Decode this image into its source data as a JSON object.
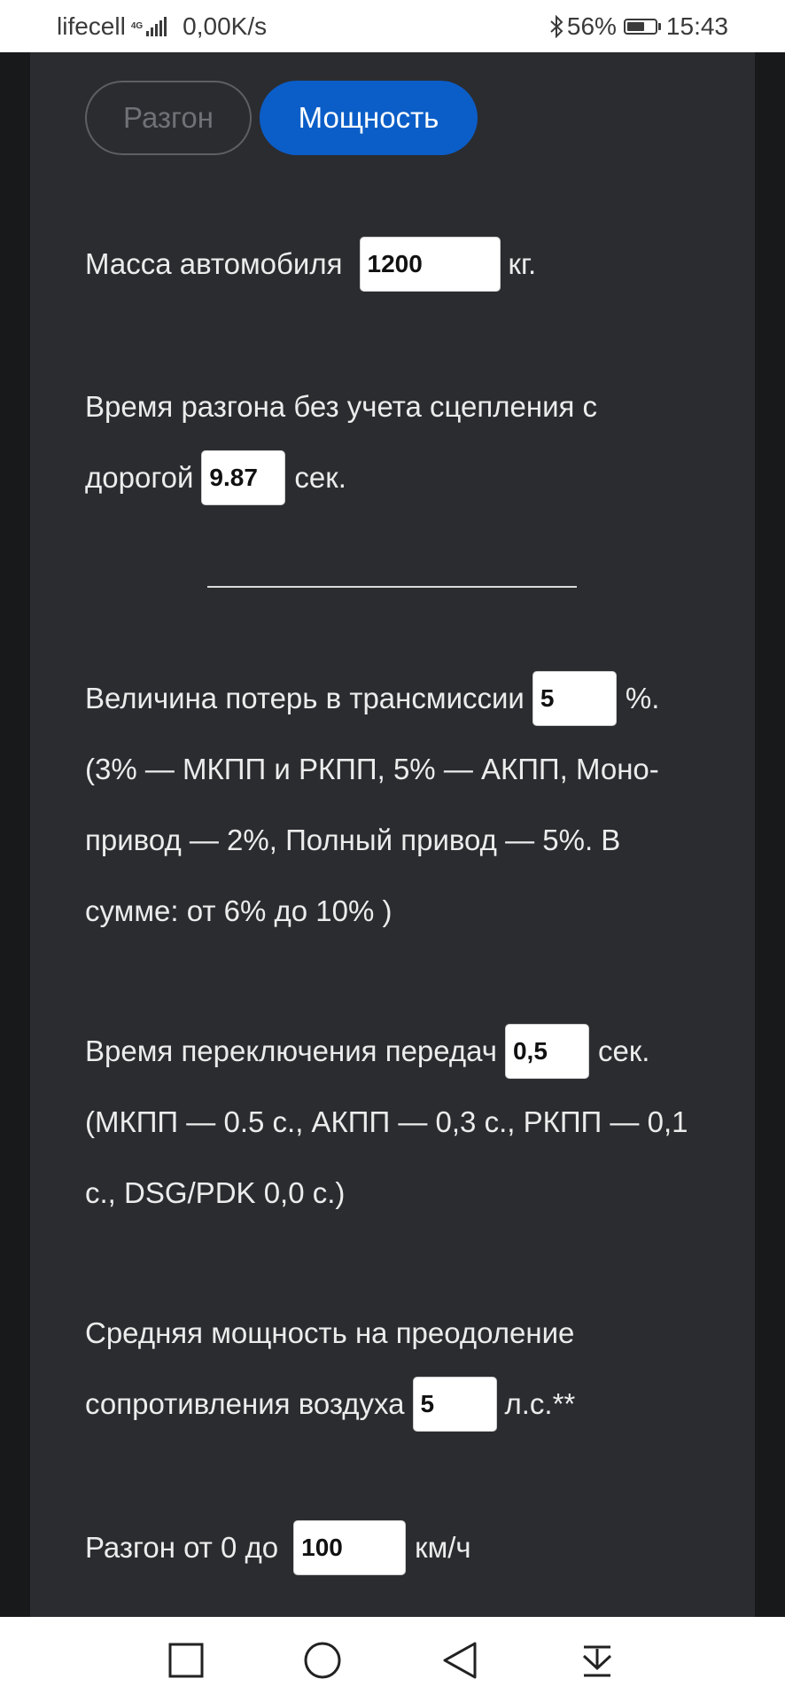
{
  "status_bar": {
    "carrier": "lifecell",
    "network_type": "4G",
    "speed": "0,00K/s",
    "battery": "56%",
    "time": "15:43"
  },
  "tabs": [
    {
      "label": "Разгон",
      "active": false
    },
    {
      "label": "Мощность",
      "active": true
    }
  ],
  "form": {
    "mass": {
      "label": "Масса автомобиля",
      "value": "1200",
      "unit": "кг."
    },
    "accel_time": {
      "line1": "Время разгона без учета сцепления с",
      "label": "дорогой",
      "value": "9.87",
      "unit": "сек."
    },
    "transmission_loss": {
      "label": "Величина потерь в трансмиссии",
      "value": "5",
      "unit": "%.",
      "note_lines": [
        "(3% — МКПП и РКПП, 5% — АКПП, Моно-",
        "привод — 2%, Полный привод — 5%. В",
        "сумме: от 6% до 10% )"
      ]
    },
    "shift_time": {
      "label": "Время переключения передач",
      "value": "0,5",
      "unit": "сек.",
      "note_lines": [
        "(МКПП — 0.5 с., АКПП — 0,3 с., РКПП — 0,1",
        "с., DSG/PDK 0,0 с.)"
      ]
    },
    "air_resistance": {
      "line1": "Средняя мощность на преодоление",
      "label": "сопротивления воздуха",
      "value": "5",
      "unit": "л.с.**"
    },
    "speed_range": {
      "label": "Разгон от 0 до",
      "value": "100",
      "unit": "км/ч"
    }
  },
  "colors": {
    "panel_bg": "#2b2c30",
    "page_bg": "#18191b",
    "accent": "#0b5ec8"
  },
  "icons": {
    "nav_recent": "square-icon",
    "nav_home": "circle-icon",
    "nav_back": "triangle-back-icon",
    "nav_notifications": "pull-down-icon"
  }
}
